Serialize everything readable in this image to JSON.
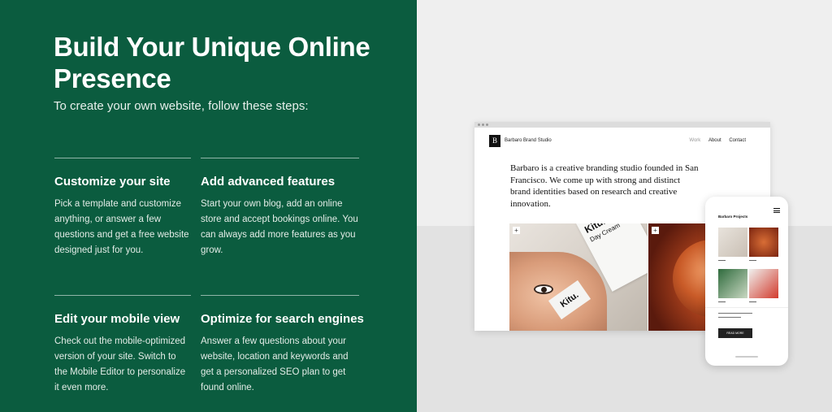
{
  "hero": {
    "title": "Build Your Unique Online Presence",
    "subtitle": "To create your own website, follow these steps:"
  },
  "steps": [
    {
      "title": "Customize your site",
      "text": "Pick a template and customize anything, or answer a few questions and get a free website designed just for you."
    },
    {
      "title": "Add advanced features",
      "text": "Start your own blog, add an online store and accept bookings online. You can always add more features as you grow."
    },
    {
      "title": "Edit your mobile view",
      "text": "Check out the mobile-optimized version of your site. Switch to the Mobile Editor to personalize it even more."
    },
    {
      "title": "Optimize for search engines",
      "text": "Answer a few questions about your website, location and keywords and get a personalized SEO plan to get found online."
    }
  ],
  "desktop_mock": {
    "logo_letter": "B",
    "brand": "Barbaro Brand Studio",
    "nav": [
      "Work",
      "About",
      "Contact"
    ],
    "intro": "Barbaro is a creative branding studio founded in San Francisco. We come up with strong and distinct brand identities based on research and creative innovation.",
    "product_name": "Kitu.",
    "product_type": "Day Cream"
  },
  "phone_mock": {
    "title": "Barbaro Projects",
    "button": "READ MORE"
  },
  "colors": {
    "left_bg": "#0b5c3f",
    "right_bg": "#efefef"
  }
}
